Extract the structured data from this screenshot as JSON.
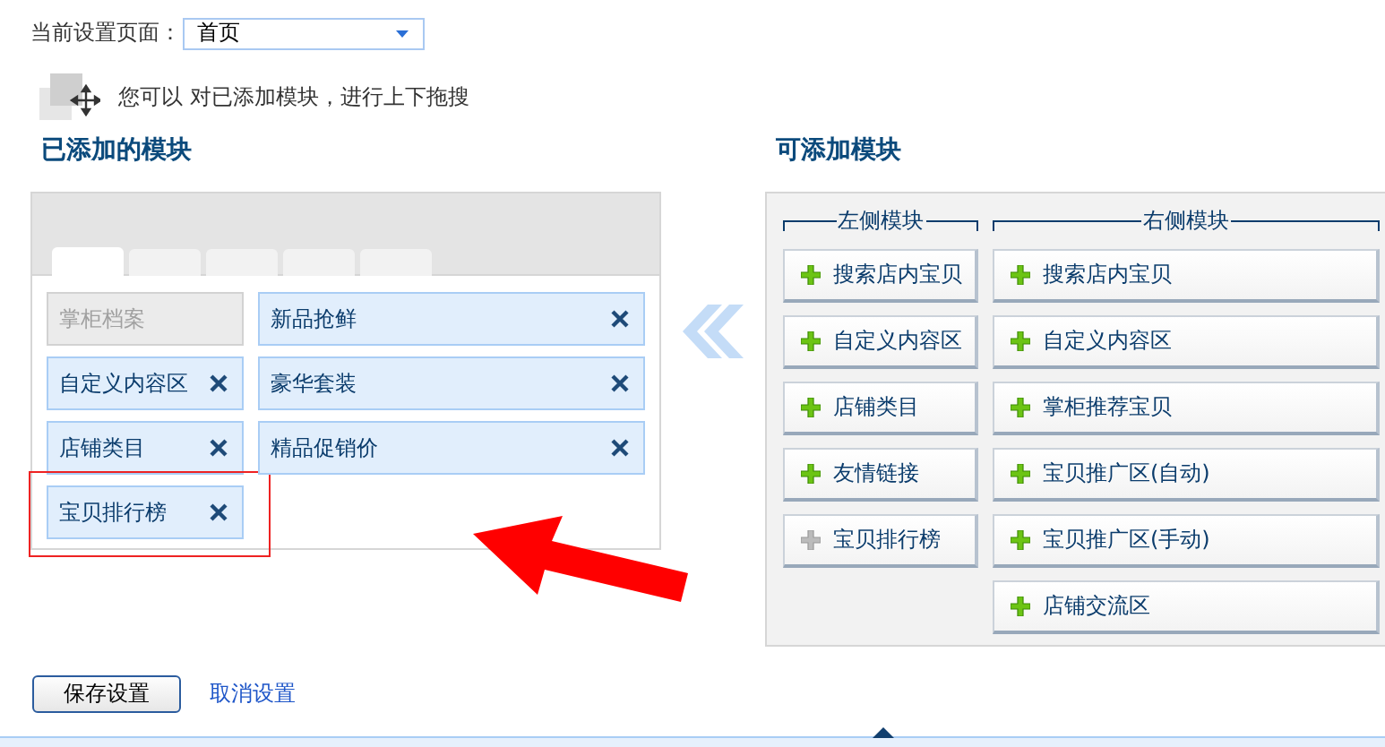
{
  "page_selector": {
    "label": "当前设置页面：",
    "value": "首页"
  },
  "hint": "您可以 对已添加模块，进行上下拖搜",
  "added": {
    "title": "已添加的模块",
    "tabs": [
      {
        "selected": true
      },
      {
        "selected": false
      },
      {
        "selected": false
      },
      {
        "selected": false
      },
      {
        "selected": false
      }
    ],
    "left_column": [
      {
        "label": "掌柜档案",
        "kind": "fixed",
        "highlighted": false
      },
      {
        "label": "自定义内容区",
        "kind": "removable",
        "highlighted": false
      },
      {
        "label": "店铺类目",
        "kind": "removable",
        "highlighted": false
      },
      {
        "label": "宝贝排行榜",
        "kind": "removable",
        "highlighted": true
      }
    ],
    "right_column": [
      {
        "label": "新品抢鲜",
        "kind": "removable",
        "highlighted": false
      },
      {
        "label": "豪华套装",
        "kind": "removable",
        "highlighted": false
      },
      {
        "label": "精品促销价",
        "kind": "removable",
        "highlighted": false
      }
    ]
  },
  "available": {
    "title": "可添加模块",
    "left": {
      "heading": "左侧模块",
      "modules": [
        {
          "label": "搜索店内宝贝",
          "disabled": false
        },
        {
          "label": "自定义内容区",
          "disabled": false
        },
        {
          "label": "店铺类目",
          "disabled": false
        },
        {
          "label": "友情链接",
          "disabled": false
        },
        {
          "label": "宝贝排行榜",
          "disabled": true
        }
      ]
    },
    "right": {
      "heading": "右侧模块",
      "modules": [
        {
          "label": "搜索店内宝贝",
          "disabled": false
        },
        {
          "label": "自定义内容区",
          "disabled": false
        },
        {
          "label": "掌柜推荐宝贝",
          "disabled": false
        },
        {
          "label": "宝贝推广区(自动)",
          "disabled": false
        },
        {
          "label": "宝贝推广区(手动)",
          "disabled": false
        },
        {
          "label": "店铺交流区",
          "disabled": false
        }
      ]
    }
  },
  "buttons": {
    "save": "保存设置",
    "cancel": "取消设置"
  }
}
